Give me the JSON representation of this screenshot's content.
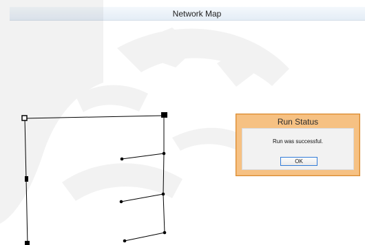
{
  "window": {
    "title": "Network Map"
  },
  "dialog": {
    "title": "Run Status",
    "message": "Run was successful.",
    "ok_label": "OK"
  }
}
